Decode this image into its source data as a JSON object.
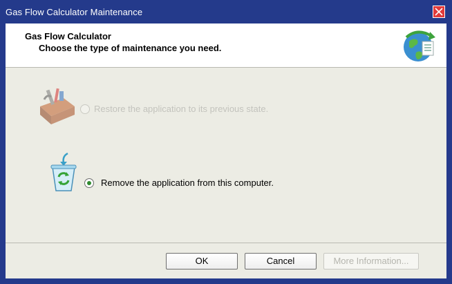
{
  "window": {
    "title": "Gas Flow Calculator Maintenance"
  },
  "header": {
    "app_name": "Gas Flow Calculator",
    "subtitle": "Choose the type of maintenance you need."
  },
  "options": [
    {
      "label": "Restore the application to its previous state.",
      "selected": false,
      "enabled": false,
      "icon": "toolbox-icon"
    },
    {
      "label": "Remove the application from this computer.",
      "selected": true,
      "enabled": true,
      "icon": "recycle-bin-icon"
    }
  ],
  "buttons": {
    "ok": "OK",
    "cancel": "Cancel",
    "more_info": "More Information..."
  },
  "colors": {
    "titlebar": "#243a8b",
    "close": "#e23a3a",
    "content_bg": "#ecece4",
    "radio_selected": "#2f8a2f"
  }
}
